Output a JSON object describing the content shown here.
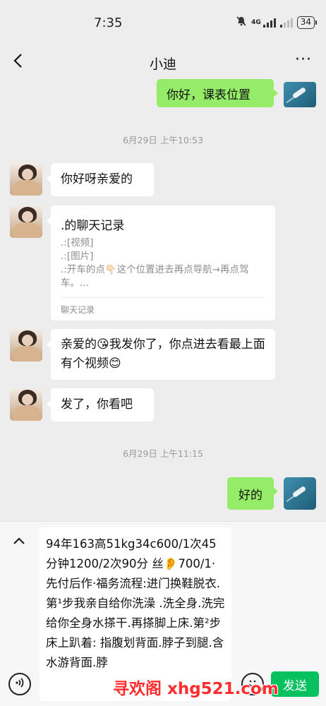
{
  "status_bar": {
    "time": "7:35",
    "network": "4G",
    "battery": "34"
  },
  "header": {
    "title": "小迪",
    "more": "···"
  },
  "messages": {
    "out_1": "你好，课表位置",
    "time_1": "6月29日 上午10:53",
    "in_1": "你好呀亲爱的",
    "record": {
      "title": ".的聊天记录",
      "line_1": ".:[视频]",
      "line_2": ".:[图片]",
      "line_3": ".:开车的点👇🏻这个位置进去再点导航→再点驾车。...",
      "footer": "聊天记录"
    },
    "in_2": "亲爱的😘我发你了，你点进去看最上面有个视频😊",
    "in_3": "发了，你看吧",
    "time_2": "6月29日 上午11:15",
    "out_2": "好的"
  },
  "input": {
    "text": "94年163高51kg34c600/1次45分钟1200/2次90分 丝👂700/1·先付后作·福务流程:进门换鞋脱衣.第¹步我亲自给你洗澡 .洗全身.洗完给你全身水搽干.再搽脚上床.第²步床上趴着: 指腹划背面.脖子到腿.含水游背面.脖"
  },
  "send_label": "发送",
  "watermark": "寻欢阁 xhg521.com",
  "colors": {
    "outgoing_bubble": "#95ec69",
    "send_button": "#07c160",
    "background": "#ededed",
    "watermark": "#ff2d2d"
  },
  "icons": {
    "back": "chevron-left-icon",
    "more": "more-dots-icon",
    "collapse": "chevron-up-icon",
    "voice": "voice-icon",
    "emoji": "emoji-icon",
    "mute": "bell-off-icon"
  }
}
